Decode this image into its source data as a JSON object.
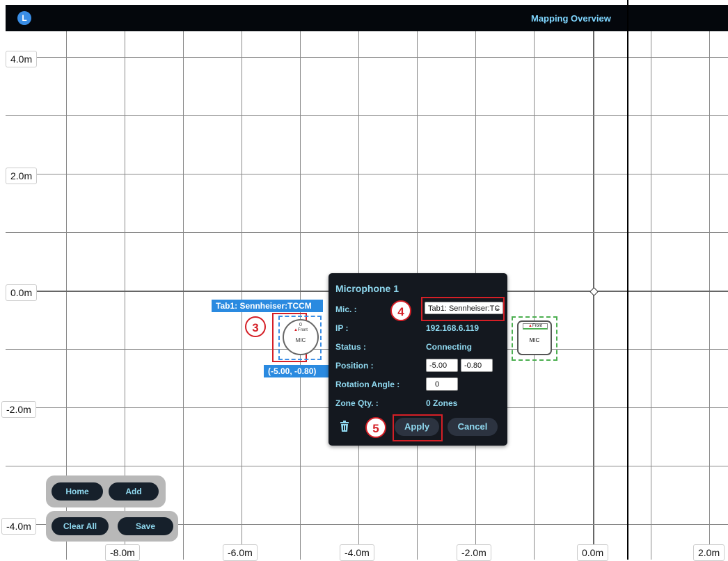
{
  "header": {
    "logo_text": "L",
    "title": "Mapping Overview"
  },
  "axis": {
    "y_labels": [
      "4.0m",
      "2.0m",
      "0.0m",
      "-2.0m",
      "-4.0m"
    ],
    "x_labels": [
      "-8.0m",
      "-6.0m",
      "-4.0m",
      "-2.0m",
      "0.0m",
      "2.0m"
    ]
  },
  "selected_mic": {
    "name_label": "Tab1: Sennheiser:TCCM",
    "coords_label": "(-5.00, -0.80)",
    "zero": "0",
    "front": "Front",
    "text": "MIC"
  },
  "other_mic": {
    "front": "Front",
    "text": "MIC"
  },
  "annotations": {
    "step3": "3",
    "step4": "4",
    "step5": "5"
  },
  "panel": {
    "title": "Microphone 1",
    "mic_label": "Mic. :",
    "mic_value": "Tab1: Sennheiser:TC",
    "ip_label": "IP :",
    "ip_value": "192.168.6.119",
    "status_label": "Status :",
    "status_value": "Connecting",
    "position_label": "Position :",
    "position_x": "-5.00",
    "position_y": "-0.80",
    "rotation_label": "Rotation Angle :",
    "rotation_value": "0",
    "zone_label": "Zone Qty. :",
    "zone_value": "0 Zones",
    "apply_label": "Apply",
    "cancel_label": "Cancel",
    "trash_icon": "trash-icon"
  },
  "controls": {
    "home": "Home",
    "add": "Add",
    "clear_all": "Clear All",
    "save": "Save"
  }
}
